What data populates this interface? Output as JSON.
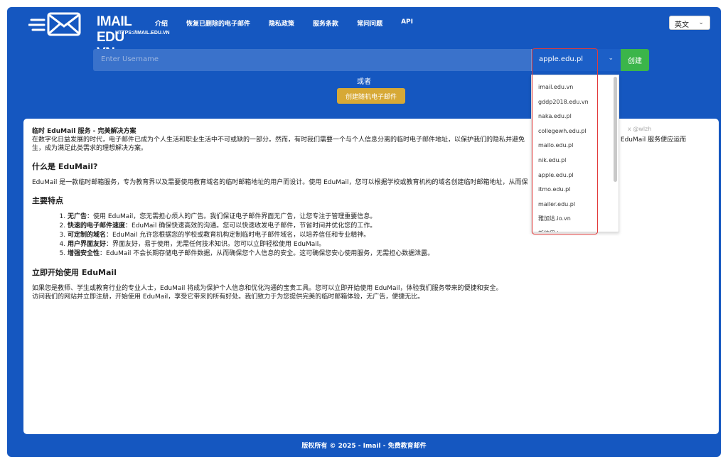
{
  "logo": {
    "text": "IMAIL EDU VN",
    "sub": "HTTPS://IMAIL.EDU.VN"
  },
  "nav": [
    "介绍",
    "恢复已删除的电子邮件",
    "隐私政策",
    "服务条款",
    "常问问题",
    "API"
  ],
  "lang": {
    "value": "英文"
  },
  "form": {
    "username_placeholder": "Enter Username",
    "domain": "apple.edu.pl",
    "create_label": "创建",
    "or_label": "或者",
    "random_label": "创建随机电子邮件"
  },
  "dropdown": {
    "options": [
      "imail.edu.vn",
      "gddp2018.edu.vn",
      "naka.edu.pl",
      "collegewh.edu.pl",
      "mailo.edu.pl",
      "nik.edu.pl",
      "apple.edu.pl",
      "itmo.edu.pl",
      "mailer.edu.pl",
      "雅加达.io.vn",
      "新德里.io.vn"
    ]
  },
  "content": {
    "watermark": "x @wlzh",
    "intro_title": "临时 EduMail 服务 - 完美解决方案",
    "intro_p1": "在数字化日益发展的时代，电子邮件已成为个人生活和职业生活中不可或缺的一部分。然而，有时我们需要一个与个人信息分离的临时电子邮件地址，以保护我们的隐私并避免",
    "intro_p1b": "时，临时 EduMail 服务便应运而",
    "intro_p2": "生，成为满足此类需求的理想解决方案。",
    "what_heading": "什么是 EduMail?",
    "what_text": "EduMail 是一款临时邮箱服务，专为教育界以及需要使用教育域名的临时邮箱地址的用户而设计。使用 EduMail，您可以根据学校或教育机构的域名创建临时邮箱地址，从而保",
    "features_heading": "主要特点",
    "features": [
      {
        "title": "无广告",
        "text": "：使用 EduMail，您无需担心烦人的广告。我们保证电子邮件界面无广告，让您专注于管理重要信息。"
      },
      {
        "title": "快速的电子邮件速度",
        "text": "：EduMail 确保快速高效的沟通。您可以快速收发电子邮件，节省时间并优化您的工作。"
      },
      {
        "title": "可定制的域名",
        "text": "：EduMail 允许您根据您的学校或教育机构定制临时电子邮件域名，以培养信任和专业精神。"
      },
      {
        "title": "用户界面友好",
        "text": "：界面友好，易于使用，无需任何技术知识。您可以立即轻松使用 EduMail。"
      },
      {
        "title": "增强安全性",
        "text": "：EduMail 不会长期存储电子邮件数据，从而确保您个人信息的安全。这可确保您安心使用服务，无需担心数据泄露。"
      }
    ],
    "start_heading": "立即开始使用 EduMail",
    "start_p1": "如果您是教师、学生或教育行业的专业人士，EduMail 将成为保护个人信息和优化沟通的宝贵工具。您可以立即开始使用 EduMail，体验我们服务带来的便捷和安全。",
    "start_p2": "访问我们的网站并立即注册，开始使用 EduMail，享受它带来的所有好处。我们致力于为您提供完美的临时邮箱体验，无广告，便捷无比。"
  },
  "footer": "版权所有 © 2025 - Imail - 免费教育邮件",
  "colors": {
    "primary": "#1557c0",
    "create": "#3bb54a",
    "random": "#d7a936",
    "highlight": "#e23b3b"
  }
}
